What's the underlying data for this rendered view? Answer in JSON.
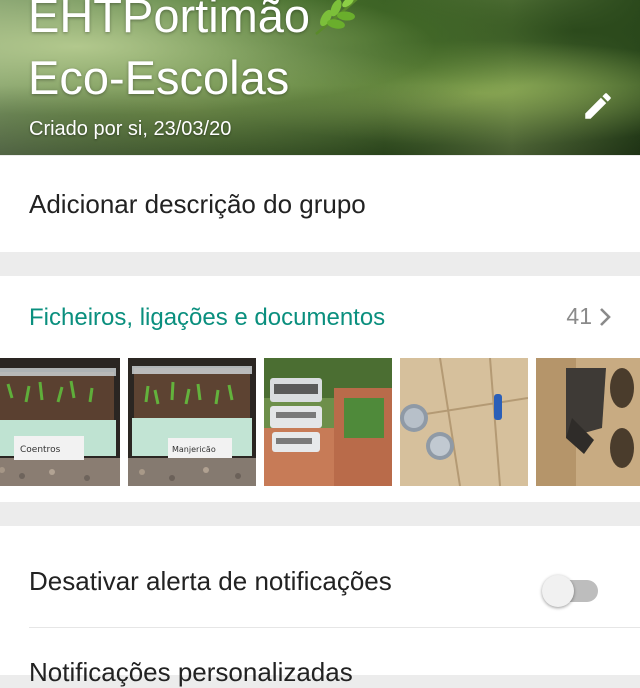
{
  "header": {
    "title_line1": "EHTPortimão",
    "title_line2": "Eco-Escolas",
    "created_text": "Criado por si, 23/03/20",
    "emoji_icon": "herb-leaf-icon",
    "edit_icon": "pencil-icon"
  },
  "description": {
    "label": "Adicionar descrição do grupo"
  },
  "media": {
    "title": "Ficheiros, ligações e documentos",
    "count": "41",
    "chevron_icon": "chevron-right-icon",
    "thumbnails": [
      {
        "label": "Coentros",
        "kind": "seedling-tray"
      },
      {
        "label": "Manjericão",
        "kind": "seedling-tray"
      },
      {
        "kind": "stacked-containers"
      },
      {
        "kind": "cans-on-cardboard"
      },
      {
        "kind": "cardboard-tube"
      }
    ]
  },
  "settings": {
    "mute_label": "Desativar alerta de notificações",
    "mute_enabled": false,
    "custom_label": "Notificações personalizadas"
  },
  "colors": {
    "accent": "#0a8f7e",
    "toggle_off_track": "#bdbdbd",
    "page_bg": "#ececec"
  }
}
